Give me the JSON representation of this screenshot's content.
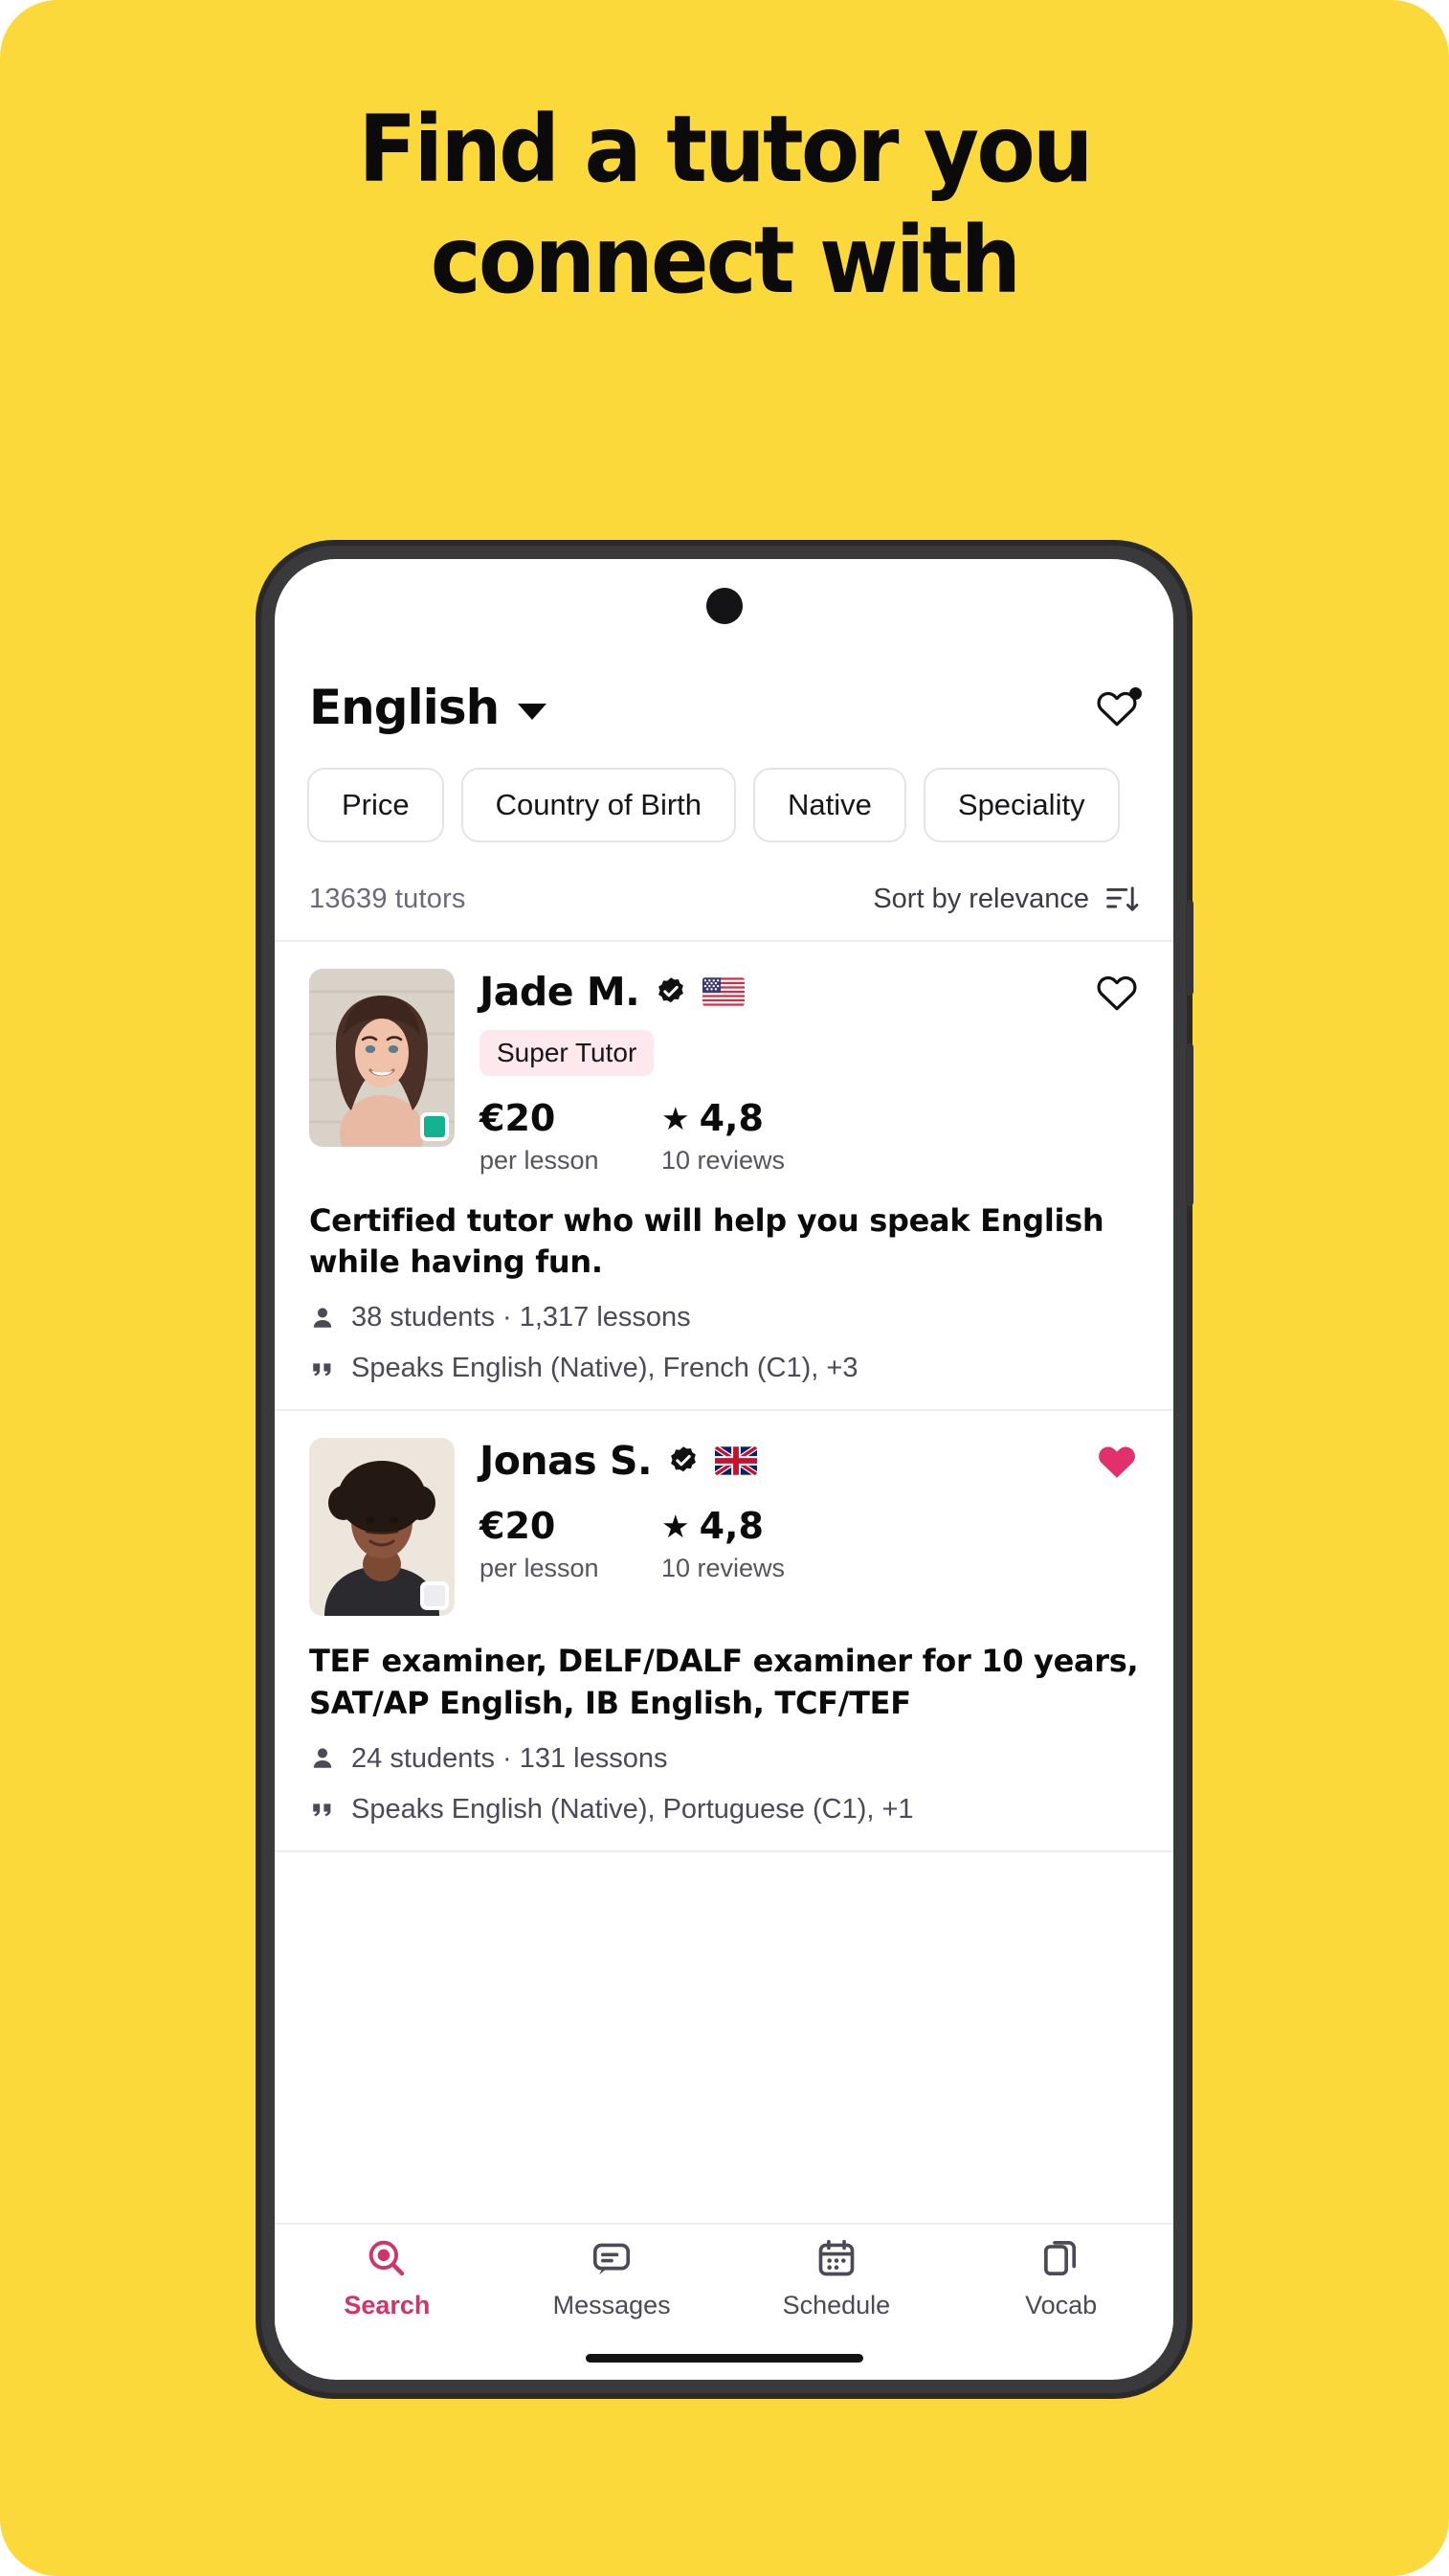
{
  "poster": {
    "background_color": "#FCD93A",
    "headline_line1": "Find a tutor you",
    "headline_line2": "connect with"
  },
  "app": {
    "header": {
      "language": "English",
      "caret_icon": "chevron-down-icon",
      "favorites_icon": "heart-outline-icon",
      "favorites_has_badge": true
    },
    "filters": {
      "chips": [
        {
          "label": "Price"
        },
        {
          "label": "Country of Birth"
        },
        {
          "label": "Native"
        },
        {
          "label": "Speciality"
        }
      ]
    },
    "results": {
      "count_label": "13639 tutors",
      "sort_label": "Sort by relevance",
      "sort_icon": "sort-descending-icon"
    },
    "tutors": [
      {
        "name": "Jade M.",
        "verified": true,
        "verified_icon": "verified-check-icon",
        "flag": "us-flag-icon",
        "online_status": "online",
        "super_tutor_label": "Super Tutor",
        "is_super_tutor": true,
        "price": "€20",
        "price_sub": "per lesson",
        "rating": "4,8",
        "rating_star": "★",
        "reviews": "10 reviews",
        "description": "Certified tutor who will help you speak English while having fun.",
        "students_icon": "person-icon",
        "stats": "38 students  ·  1,317 lessons",
        "speaks_icon": "quote-icon",
        "speaks": "Speaks English (Native), French (C1), +3",
        "favorited": false,
        "favorite_icon": "heart-outline-icon"
      },
      {
        "name": "Jonas S.",
        "verified": true,
        "verified_icon": "verified-check-icon",
        "flag": "uk-flag-icon",
        "online_status": "offline",
        "super_tutor_label": "",
        "is_super_tutor": false,
        "price": "€20",
        "price_sub": "per lesson",
        "rating": "4,8",
        "rating_star": "★",
        "reviews": "10 reviews",
        "description": "TEF examiner, DELF/DALF examiner for 10 years, SAT/AP English, IB English, TCF/TEF",
        "students_icon": "person-icon",
        "stats": "24 students  ·  131 lessons",
        "speaks_icon": "quote-icon",
        "speaks": "Speaks English (Native), Portuguese (C1), +1",
        "favorited": true,
        "favorite_icon": "heart-filled-icon"
      }
    ],
    "bottom_nav": {
      "active_color": "#D3336B",
      "items": [
        {
          "label": "Search",
          "icon": "search-icon",
          "active": true
        },
        {
          "label": "Messages",
          "icon": "message-icon",
          "active": false
        },
        {
          "label": "Schedule",
          "icon": "calendar-icon",
          "active": false
        },
        {
          "label": "Vocab",
          "icon": "cards-icon",
          "active": false
        }
      ]
    }
  }
}
